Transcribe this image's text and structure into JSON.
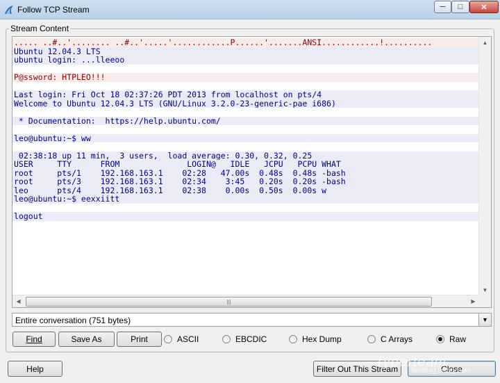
{
  "window": {
    "title": "Follow TCP Stream",
    "buttons": {
      "minimize": "─",
      "maximize": "□",
      "close": "✕"
    }
  },
  "stream": {
    "group_label": "Stream Content",
    "lines": [
      {
        "kind": "client",
        "text": "..... ..#..'........ ..#..'.....'............P......'.......ANSI............!.........."
      },
      {
        "kind": "server",
        "text": "Ubuntu 12.04.3 LTS"
      },
      {
        "kind": "server",
        "text": "ubuntu login: ...lleeoo"
      },
      {
        "kind": "blank",
        "text": ""
      },
      {
        "kind": "client",
        "text": "P@ssword: HTPLEO!!!"
      },
      {
        "kind": "blank",
        "text": ""
      },
      {
        "kind": "server",
        "text": "Last login: Fri Oct 18 02:37:26 PDT 2013 from localhost on pts/4"
      },
      {
        "kind": "server",
        "text": "Welcome to Ubuntu 12.04.3 LTS (GNU/Linux 3.2.0-23-generic-pae i686)"
      },
      {
        "kind": "blank",
        "text": ""
      },
      {
        "kind": "server",
        "text": " * Documentation:  https://help.ubuntu.com/"
      },
      {
        "kind": "blank",
        "text": ""
      },
      {
        "kind": "server",
        "text": "leo@ubuntu:~$ ww"
      },
      {
        "kind": "blank",
        "text": ""
      },
      {
        "kind": "server",
        "text": " 02:38:18 up 11 min,  3 users,  load average: 0.30, 0.32, 0.25"
      },
      {
        "kind": "server",
        "text": "USER     TTY      FROM              LOGIN@   IDLE   JCPU   PCPU WHAT"
      },
      {
        "kind": "server",
        "text": "root     pts/1    192.168.163.1    02:28   47.00s  0.48s  0.48s -bash"
      },
      {
        "kind": "server",
        "text": "root     pts/3    192.168.163.1    02:34    3:45   0.20s  0.20s -bash"
      },
      {
        "kind": "server",
        "text": "leo      pts/4    192.168.163.1    02:38    0.00s  0.50s  0.00s w"
      },
      {
        "kind": "server",
        "text": "leo@ubuntu:~$ eexxiitt"
      },
      {
        "kind": "blank",
        "text": ""
      },
      {
        "kind": "server",
        "text": "logout"
      }
    ]
  },
  "scroll": {
    "up": "▲",
    "down": "▼",
    "left": "◀",
    "right": "▶",
    "grip": "|||"
  },
  "conversation": {
    "selected": "Entire conversation (751 bytes)",
    "arrow": "▼"
  },
  "actions": {
    "find": "Find",
    "save_as": "Save As",
    "print": "Print"
  },
  "format_options": [
    {
      "label": "ASCII",
      "selected": false
    },
    {
      "label": "EBCDIC",
      "selected": false
    },
    {
      "label": "Hex Dump",
      "selected": false
    },
    {
      "label": "C Arrays",
      "selected": false
    },
    {
      "label": "Raw",
      "selected": true
    }
  ],
  "footer": {
    "help": "Help",
    "filter_out": "Filter Out This Stream",
    "close": "Close"
  },
  "watermark": {
    "text": "Typerteam",
    "url": "twodrag.tistory.com"
  },
  "colors": {
    "client_text": "#8b0000",
    "client_bg": "#fbeaea",
    "server_text": "#000080",
    "server_bg": "#ebebf7"
  }
}
